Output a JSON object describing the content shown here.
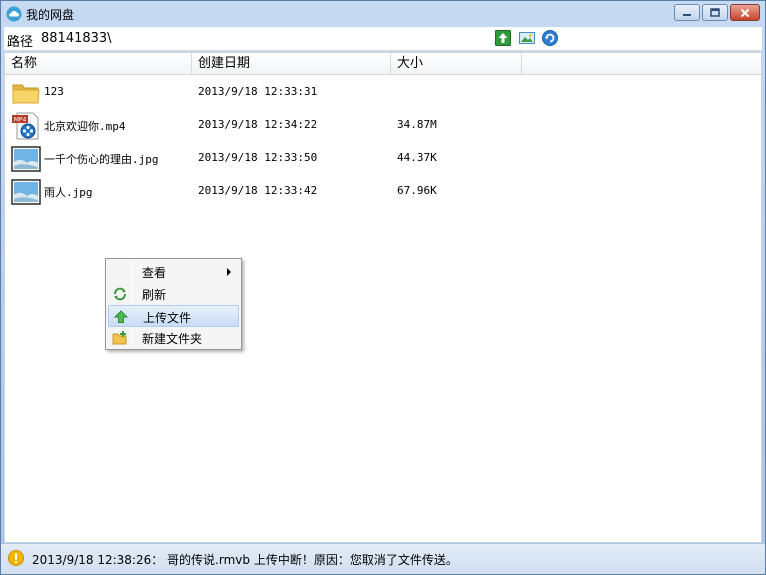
{
  "window": {
    "title": "我的网盘"
  },
  "path": {
    "label": "路径",
    "value": "88141833\\"
  },
  "toolbar": {
    "icons": [
      "upload-icon",
      "image-view-icon",
      "refresh-icon"
    ]
  },
  "columns": [
    "名称",
    "创建日期",
    "大小"
  ],
  "files": [
    {
      "name": "123",
      "date": "2013/9/18 12:33:31",
      "size": "",
      "type": "folder"
    },
    {
      "name": "北京欢迎你.mp4",
      "date": "2013/9/18 12:34:22",
      "size": "34.87M",
      "type": "video",
      "badge": "MP4"
    },
    {
      "name": "一千个伤心的理由.jpg",
      "date": "2013/9/18 12:33:50",
      "size": "44.37K",
      "type": "image"
    },
    {
      "name": "雨人.jpg",
      "date": "2013/9/18 12:33:42",
      "size": "67.96K",
      "type": "image"
    }
  ],
  "context_menu": {
    "items": [
      {
        "label": "查看",
        "icon": "",
        "submenu": true,
        "highlighted": false
      },
      {
        "label": "刷新",
        "icon": "refresh-icon",
        "submenu": false,
        "highlighted": false
      },
      {
        "label": "上传文件",
        "icon": "upload-icon",
        "submenu": false,
        "highlighted": true
      },
      {
        "label": "新建文件夹",
        "icon": "new-folder-icon",
        "submenu": false,
        "highlighted": false
      }
    ]
  },
  "status": {
    "text": "2013/9/18 12:38:26： 哥的传说.rmvb 上传中断！原因：您取消了文件传送。",
    "icon": "warning-icon"
  },
  "colors": {
    "title_bar": "#b9d1ee",
    "highlight": "#cfe2f8",
    "folder": "#f3cf62",
    "warning": "#f0b400"
  }
}
